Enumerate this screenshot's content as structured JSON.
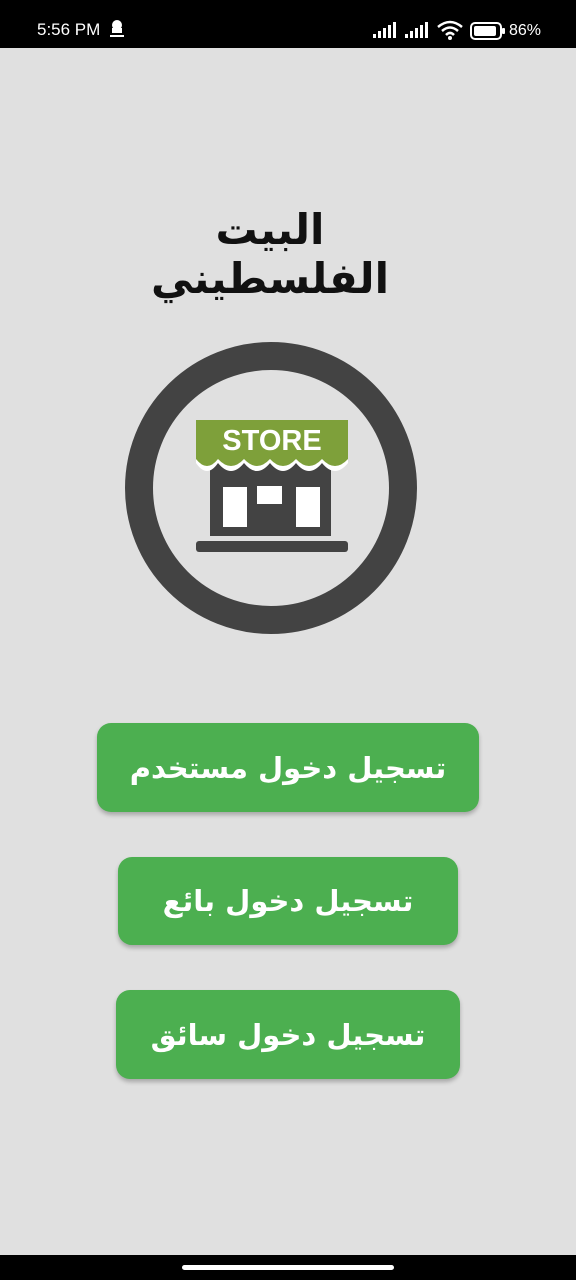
{
  "status_bar": {
    "time": "5:56 PM",
    "battery": "86%",
    "icons": [
      "notification-icon",
      "signal-icon",
      "signal-icon",
      "wifi-icon",
      "battery-icon"
    ]
  },
  "app": {
    "title": "البيت الفلسطيني",
    "logo_text": "STORE"
  },
  "buttons": {
    "user_login": "تسجيل دخول مستخدم",
    "seller_login": "تسجيل دخول بائع",
    "driver_login": "تسجيل دخول سائق"
  },
  "colors": {
    "background": "#e0e0e0",
    "button": "#4caf50",
    "awning": "#7ea03a",
    "logo_dark": "#434343"
  }
}
